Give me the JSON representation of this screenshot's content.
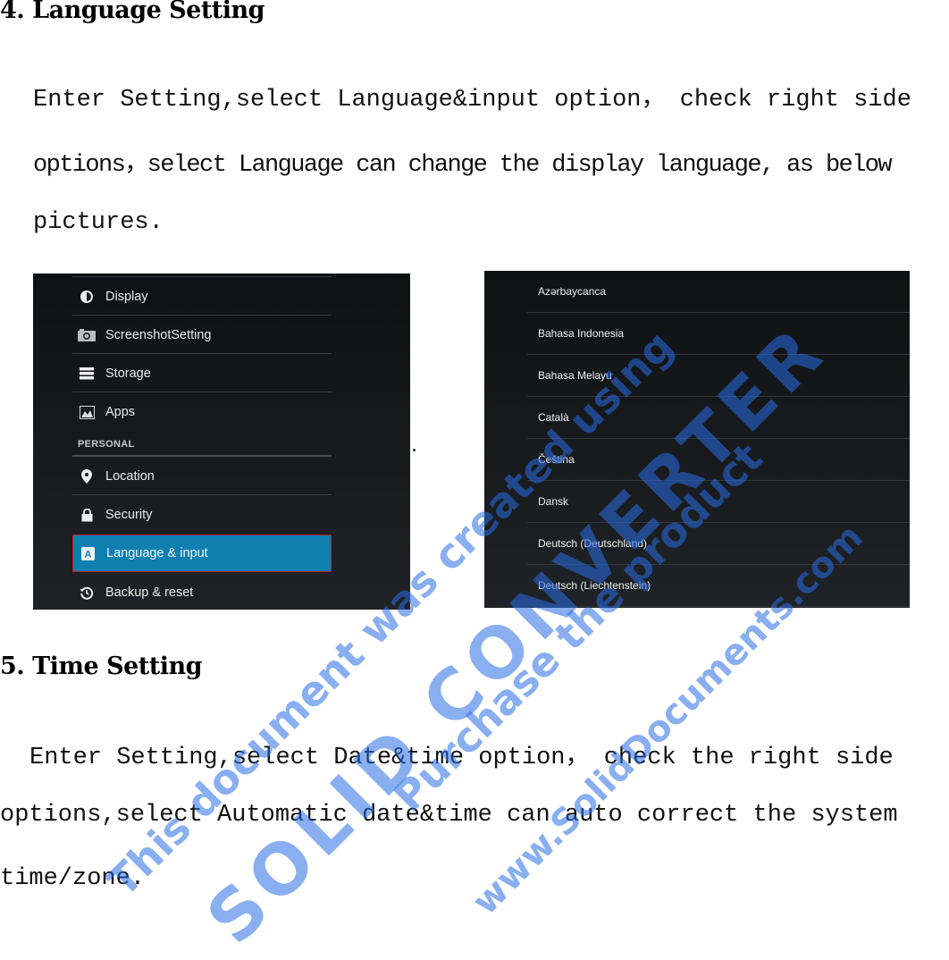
{
  "sections": [
    {
      "heading": "4. Language Setting",
      "lines": [
        "Enter  Setting,select  Language&input  option，  check  right  side",
        "options，select Language can change the display language, as below",
        "pictures."
      ]
    },
    {
      "heading": "5. Time Setting",
      "lines": [
        "Enter  Setting,select  Date&time  option，  check  the  right  side",
        "options,select  Automatic  date&time  can  auto  correct  the  system",
        "time/zone."
      ]
    }
  ],
  "settings_screenshot": {
    "items": [
      {
        "label": "Display",
        "icon": "brightness-icon"
      },
      {
        "label": "ScreenshotSetting",
        "icon": "camera-icon"
      },
      {
        "label": "Storage",
        "icon": "storage-icon"
      },
      {
        "label": "Apps",
        "icon": "apps-icon"
      }
    ],
    "section_label": "PERSONAL",
    "personal_items": [
      {
        "label": "Location",
        "icon": "location-pin-icon"
      },
      {
        "label": "Security",
        "icon": "lock-icon"
      },
      {
        "label": "Language & input",
        "icon": "language-icon",
        "selected": true
      },
      {
        "label": "Backup & reset",
        "icon": "backup-restore-icon"
      }
    ],
    "selected_color": "#0f7fb0",
    "highlight_border_color": "#c0202a"
  },
  "language_screenshot": {
    "languages": [
      "Azərbaycanca",
      "Bahasa Indonesia",
      "Bahasa Melayu",
      "Català",
      "Čeština",
      "Dansk",
      "Deutsch (Deutschland)",
      "Deutsch (Liechtenstein)"
    ]
  },
  "watermark": {
    "line1": "This document was created using",
    "line2": "SOLID CONVERTER",
    "line3": "Purchase the product",
    "line4": "www.SolidDocuments.com"
  }
}
